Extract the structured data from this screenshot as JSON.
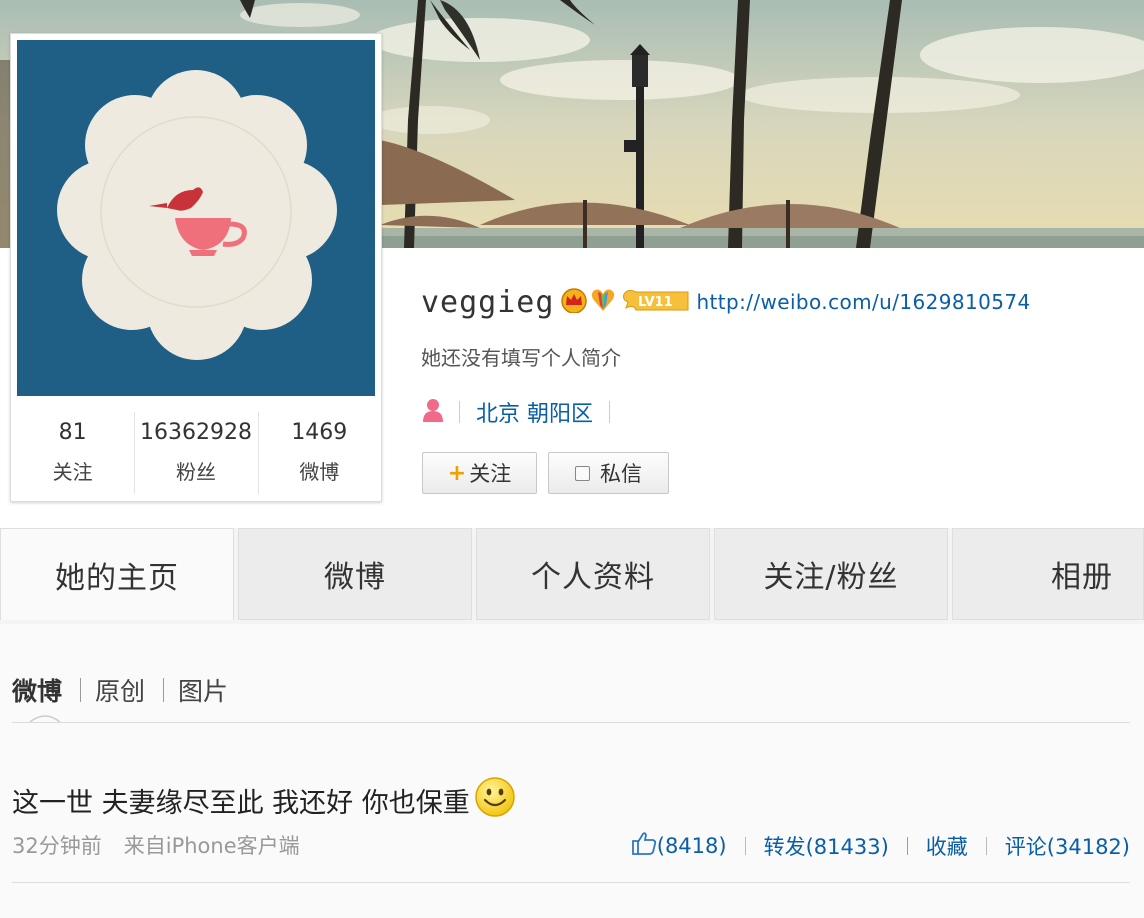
{
  "profile": {
    "username": "veggieg",
    "url": "http://weibo.com/u/1629810574",
    "bio": "她还没有填写个人简介",
    "location": "北京 朝阳区",
    "level_badge": "LV11"
  },
  "stats": [
    {
      "value": "81",
      "label": "关注"
    },
    {
      "value": "16362928",
      "label": "粉丝"
    },
    {
      "value": "1469",
      "label": "微博"
    }
  ],
  "buttons": {
    "follow": "关注",
    "message": "私信"
  },
  "tabs": [
    "她的主页",
    "微博",
    "个人资料",
    "关注/粉丝",
    "相册"
  ],
  "subtabs": [
    "微博",
    "原创",
    "图片"
  ],
  "post": {
    "text": "这一世 夫妻缘尽至此 我还好 你也保重",
    "time": "32分钟前",
    "source": "来自iPhone客户端",
    "likes": "(8418)",
    "repost": "转发(81433)",
    "favorite": "收藏",
    "comment": "评论(34182)"
  },
  "colors": {
    "link": "#0a5ea8",
    "avatar_bg": "#1f5f85",
    "follow_plus": "#f0a000"
  },
  "icons": [
    "crown-icon",
    "rainbow-heart-icon",
    "level-badge-icon",
    "person-icon",
    "thumbs-up-icon",
    "smiley-icon",
    "message-icon"
  ]
}
